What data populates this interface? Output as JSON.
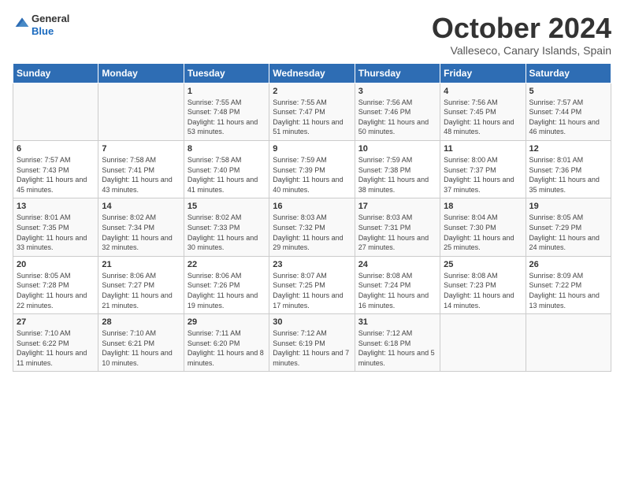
{
  "logo": {
    "general": "General",
    "blue": "Blue"
  },
  "header": {
    "month": "October 2024",
    "location": "Valleseco, Canary Islands, Spain"
  },
  "days_of_week": [
    "Sunday",
    "Monday",
    "Tuesday",
    "Wednesday",
    "Thursday",
    "Friday",
    "Saturday"
  ],
  "weeks": [
    [
      {
        "day": null,
        "content": ""
      },
      {
        "day": null,
        "content": ""
      },
      {
        "day": "1",
        "content": "Sunrise: 7:55 AM\nSunset: 7:48 PM\nDaylight: 11 hours and 53 minutes."
      },
      {
        "day": "2",
        "content": "Sunrise: 7:55 AM\nSunset: 7:47 PM\nDaylight: 11 hours and 51 minutes."
      },
      {
        "day": "3",
        "content": "Sunrise: 7:56 AM\nSunset: 7:46 PM\nDaylight: 11 hours and 50 minutes."
      },
      {
        "day": "4",
        "content": "Sunrise: 7:56 AM\nSunset: 7:45 PM\nDaylight: 11 hours and 48 minutes."
      },
      {
        "day": "5",
        "content": "Sunrise: 7:57 AM\nSunset: 7:44 PM\nDaylight: 11 hours and 46 minutes."
      }
    ],
    [
      {
        "day": "6",
        "content": "Sunrise: 7:57 AM\nSunset: 7:43 PM\nDaylight: 11 hours and 45 minutes."
      },
      {
        "day": "7",
        "content": "Sunrise: 7:58 AM\nSunset: 7:41 PM\nDaylight: 11 hours and 43 minutes."
      },
      {
        "day": "8",
        "content": "Sunrise: 7:58 AM\nSunset: 7:40 PM\nDaylight: 11 hours and 41 minutes."
      },
      {
        "day": "9",
        "content": "Sunrise: 7:59 AM\nSunset: 7:39 PM\nDaylight: 11 hours and 40 minutes."
      },
      {
        "day": "10",
        "content": "Sunrise: 7:59 AM\nSunset: 7:38 PM\nDaylight: 11 hours and 38 minutes."
      },
      {
        "day": "11",
        "content": "Sunrise: 8:00 AM\nSunset: 7:37 PM\nDaylight: 11 hours and 37 minutes."
      },
      {
        "day": "12",
        "content": "Sunrise: 8:01 AM\nSunset: 7:36 PM\nDaylight: 11 hours and 35 minutes."
      }
    ],
    [
      {
        "day": "13",
        "content": "Sunrise: 8:01 AM\nSunset: 7:35 PM\nDaylight: 11 hours and 33 minutes."
      },
      {
        "day": "14",
        "content": "Sunrise: 8:02 AM\nSunset: 7:34 PM\nDaylight: 11 hours and 32 minutes."
      },
      {
        "day": "15",
        "content": "Sunrise: 8:02 AM\nSunset: 7:33 PM\nDaylight: 11 hours and 30 minutes."
      },
      {
        "day": "16",
        "content": "Sunrise: 8:03 AM\nSunset: 7:32 PM\nDaylight: 11 hours and 29 minutes."
      },
      {
        "day": "17",
        "content": "Sunrise: 8:03 AM\nSunset: 7:31 PM\nDaylight: 11 hours and 27 minutes."
      },
      {
        "day": "18",
        "content": "Sunrise: 8:04 AM\nSunset: 7:30 PM\nDaylight: 11 hours and 25 minutes."
      },
      {
        "day": "19",
        "content": "Sunrise: 8:05 AM\nSunset: 7:29 PM\nDaylight: 11 hours and 24 minutes."
      }
    ],
    [
      {
        "day": "20",
        "content": "Sunrise: 8:05 AM\nSunset: 7:28 PM\nDaylight: 11 hours and 22 minutes."
      },
      {
        "day": "21",
        "content": "Sunrise: 8:06 AM\nSunset: 7:27 PM\nDaylight: 11 hours and 21 minutes."
      },
      {
        "day": "22",
        "content": "Sunrise: 8:06 AM\nSunset: 7:26 PM\nDaylight: 11 hours and 19 minutes."
      },
      {
        "day": "23",
        "content": "Sunrise: 8:07 AM\nSunset: 7:25 PM\nDaylight: 11 hours and 17 minutes."
      },
      {
        "day": "24",
        "content": "Sunrise: 8:08 AM\nSunset: 7:24 PM\nDaylight: 11 hours and 16 minutes."
      },
      {
        "day": "25",
        "content": "Sunrise: 8:08 AM\nSunset: 7:23 PM\nDaylight: 11 hours and 14 minutes."
      },
      {
        "day": "26",
        "content": "Sunrise: 8:09 AM\nSunset: 7:22 PM\nDaylight: 11 hours and 13 minutes."
      }
    ],
    [
      {
        "day": "27",
        "content": "Sunrise: 7:10 AM\nSunset: 6:22 PM\nDaylight: 11 hours and 11 minutes."
      },
      {
        "day": "28",
        "content": "Sunrise: 7:10 AM\nSunset: 6:21 PM\nDaylight: 11 hours and 10 minutes."
      },
      {
        "day": "29",
        "content": "Sunrise: 7:11 AM\nSunset: 6:20 PM\nDaylight: 11 hours and 8 minutes."
      },
      {
        "day": "30",
        "content": "Sunrise: 7:12 AM\nSunset: 6:19 PM\nDaylight: 11 hours and 7 minutes."
      },
      {
        "day": "31",
        "content": "Sunrise: 7:12 AM\nSunset: 6:18 PM\nDaylight: 11 hours and 5 minutes."
      },
      {
        "day": null,
        "content": ""
      },
      {
        "day": null,
        "content": ""
      }
    ]
  ]
}
